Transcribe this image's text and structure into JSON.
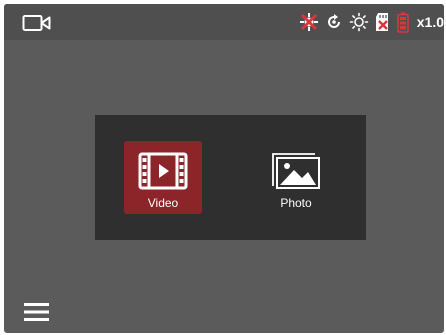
{
  "status_bar": {
    "left_icon": "video-camera-icon",
    "icons": [
      "gps-off-icon",
      "rotate-icon",
      "brightness-icon",
      "sd-card-error-icon",
      "battery-low-icon"
    ],
    "zoom_label": "x1.0"
  },
  "mode_panel": {
    "modes": [
      {
        "label": "Video",
        "icon": "video-film-icon",
        "selected": true
      },
      {
        "label": "Photo",
        "icon": "photo-gallery-icon",
        "selected": false
      }
    ]
  },
  "bottom": {
    "menu_icon": "hamburger-menu-icon"
  },
  "colors": {
    "screen_bg": "#5b5b5b",
    "statusbar_bg": "#4f4f4f",
    "panel_bg": "#2f2f2f",
    "selected_accent": "#8c2529",
    "alert_red": "#d9363e"
  }
}
